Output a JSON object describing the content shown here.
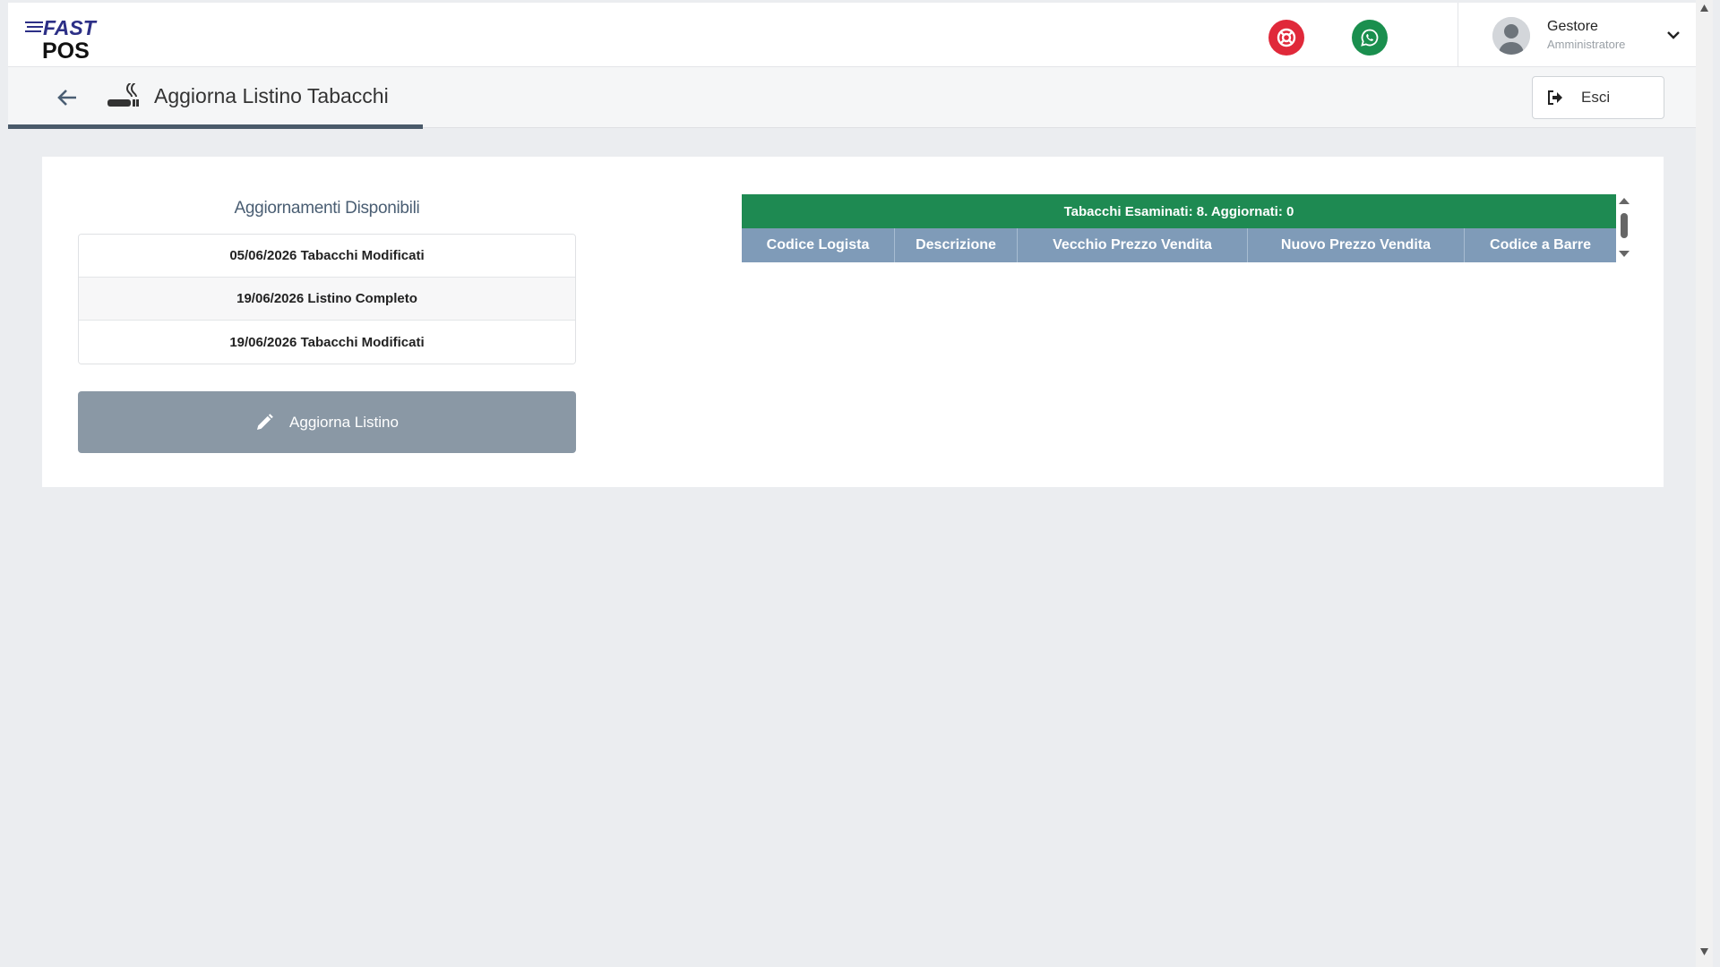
{
  "brand": {
    "logo_top": "FAST",
    "logo_bottom": "POS"
  },
  "header": {
    "user_name": "Gestore",
    "user_role": "Amministratore"
  },
  "page": {
    "title": "Aggiorna Listino Tabacchi",
    "exit_label": "Esci"
  },
  "updates": {
    "title": "Aggiornamenti Disponibili",
    "items": [
      {
        "label": "05/06/2026 Tabacchi Modificati"
      },
      {
        "label": "19/06/2026 Listino Completo"
      },
      {
        "label": "19/06/2026 Tabacchi Modificati"
      }
    ],
    "button_label": "Aggiorna Listino"
  },
  "table": {
    "summary": "Tabacchi Esaminati: 8. Aggiornati: 0",
    "columns": [
      "Codice Logista",
      "Descrizione",
      "Vecchio Prezzo Vendita",
      "Nuovo Prezzo Vendita",
      "Codice a Barre"
    ]
  },
  "colors": {
    "summary_green": "#1e8a52",
    "header_blue": "#7f9bb8",
    "button_gray": "#8a98a5",
    "support_red": "#e0293a",
    "whatsapp_green": "#1a8f4e"
  },
  "icons": {
    "back": "arrow-left-icon",
    "section": "cigarette-icon",
    "exit": "sign-out-icon",
    "pencil": "pencil-icon",
    "support": "lifebuoy-icon",
    "whatsapp": "whatsapp-icon",
    "chevron": "chevron-down-icon"
  }
}
